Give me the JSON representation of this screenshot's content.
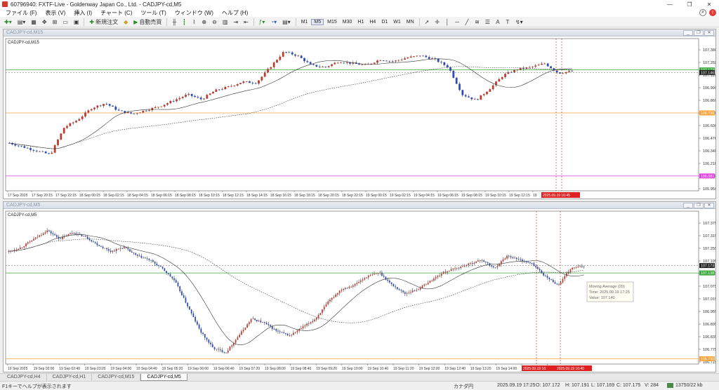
{
  "window": {
    "title": "60796940: FXTF-Live - Goldenway Japan Co., Ltd. - CADJPY-cd,M5"
  },
  "menu": [
    "ファイル (F)",
    "表示 (V)",
    "挿入 (I)",
    "チャート (C)",
    "ツール (T)",
    "ウィンドウ (W)",
    "ヘルプ (H)"
  ],
  "toolbar": {
    "new_order": "新規注文",
    "auto_trading": "自動売買",
    "timeframes": [
      "M1",
      "M5",
      "M15",
      "M30",
      "H1",
      "H4",
      "D1",
      "W1",
      "MN"
    ],
    "active_tf": "M5"
  },
  "charts": [
    {
      "caption": "CADJPY-cd,M15",
      "label": "CADJPY-cd,M15",
      "price_ticks": [
        "107.380",
        "107.250",
        "107.120",
        "106.990",
        "106.860",
        "106.730",
        "106.600",
        "106.470",
        "106.340",
        "106.210",
        "106.080",
        "105.950"
      ],
      "levels": {
        "current": "107.146",
        "ask": "107.173",
        "orange": "106.730",
        "magenta": "106.081"
      },
      "time_ticks": [
        "17 Sep 2025",
        "17 Sep 20:15",
        "17 Sep 22:15",
        "18 Sep 00:15",
        "18 Sep 02:15",
        "18 Sep 04:15",
        "18 Sep 06:15",
        "18 Sep 08:15",
        "18 Sep 10:15",
        "18 Sep 12:15",
        "18 Sep 14:15",
        "18 Sep 16:15",
        "18 Sep 18:15",
        "18 Sep 20:15",
        "18 Sep 22:15",
        "19 Sep 00:15",
        "19 Sep 02:15",
        "19 Sep 04:15",
        "19 Sep 06:15",
        "19 Sep 08:15",
        "19 Sep 10:15",
        "19 Sep 12:15",
        "19"
      ],
      "time_highlight": "2025.09.19 16:45"
    },
    {
      "caption": "CADJPY-cd,M5",
      "label": "CADJPY-cd,M5",
      "price_ticks": [
        "107.375",
        "107.315",
        "107.255",
        "107.195",
        "107.135",
        "107.075",
        "107.015",
        "106.955",
        "106.895",
        "106.835",
        "106.775",
        "106.715"
      ],
      "levels": {
        "current": "107.173",
        "ask": "107.138",
        "orange": "106.730"
      },
      "time_ticks": [
        "19 Sep 2025",
        "19 Sep 02:00",
        "19 Sep 02:40",
        "19 Sep 03:20",
        "19 Sep 04:00",
        "19 Sep 04:40",
        "19 Sep 05:20",
        "19 Sep 06:00",
        "19 Sep 06:40",
        "19 Sep 07:20",
        "19 Sep 08:00",
        "19 Sep 08:40",
        "19 Sep 09:20",
        "19 Sep 10:00",
        "19 Sep 10:40",
        "19 Sep 11:20",
        "19 Sep 12:00",
        "19 Sep 12:40",
        "19 Sep 13:20",
        "19 Sep 14:00",
        "19 Sep 14:40",
        "19 Sep 17:20"
      ],
      "time_highlight_a": "2025.09.19 16:",
      "time_highlight_b": "2025.09.19 16:40",
      "tooltip": {
        "line1": "Moving Average (20)",
        "line2": "Time: 2025.09.19 17:25",
        "line3": "Value: 107.140"
      }
    }
  ],
  "tabs": [
    "CADJPY-cd,H4",
    "CADJPY-cd,H1",
    "CADJPY-cd,M15",
    "CADJPY-cd,M5"
  ],
  "active_tab": "CADJPY-cd,M5",
  "status": {
    "help": "F1キーでヘルプが表示されます",
    "profile": "カナダ円",
    "datetime": "2025.09.19 17:25",
    "open": "O: 107.172",
    "high": "H: 107.191",
    "low": "L: 107.169",
    "close": "C: 107.175",
    "volume": "V: 284",
    "traffic": "13750/22 kb"
  },
  "colors": {
    "bull": "#c0392b",
    "bear": "#2c4bb8",
    "green_level": "#3aa83a",
    "orange_level": "#f7a33a",
    "magenta_level": "#e040e0",
    "highlight": "#e02020"
  }
}
